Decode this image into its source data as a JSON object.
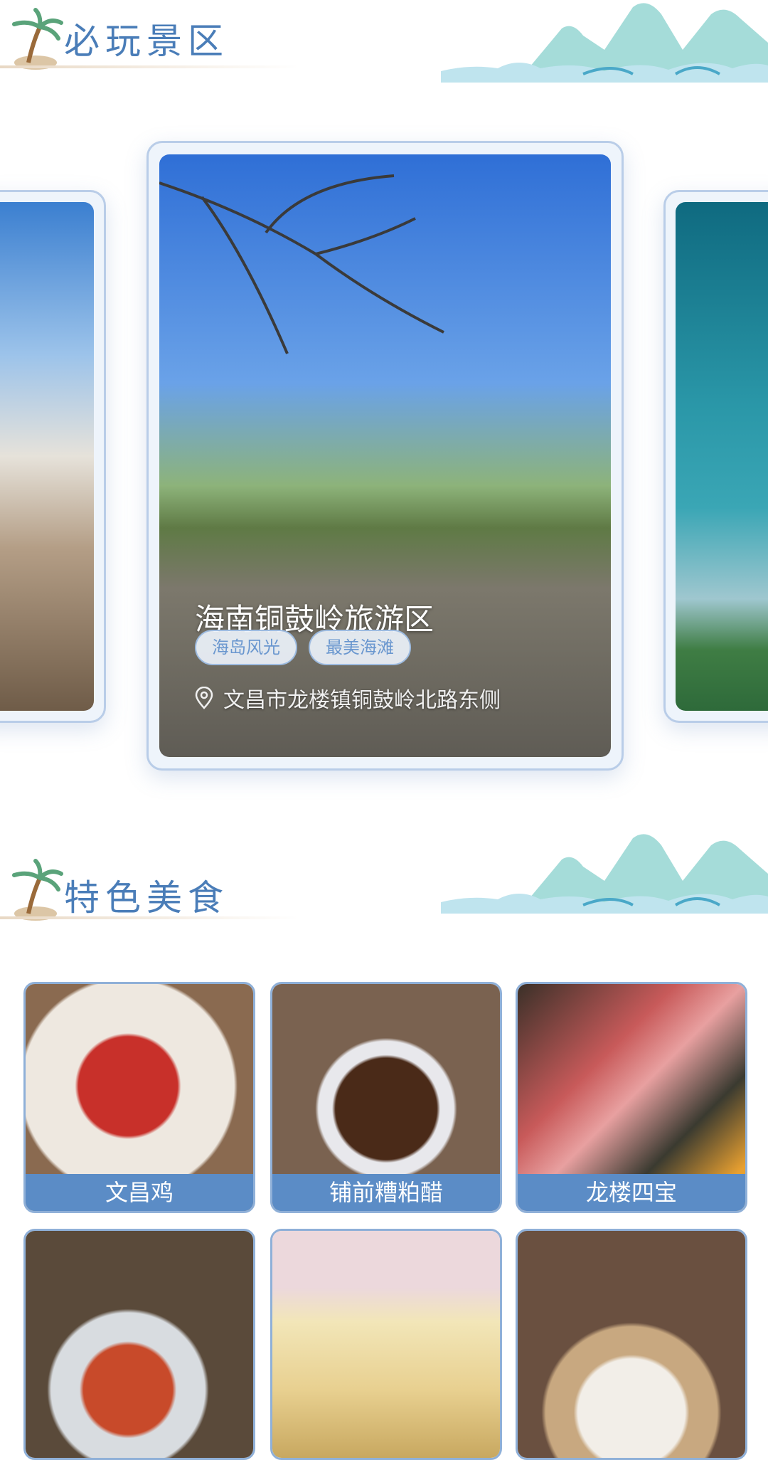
{
  "sections": {
    "scenic": {
      "title": "必玩景区"
    },
    "food": {
      "title": "特色美食"
    }
  },
  "carousel": {
    "active": {
      "name": "海南铜鼓岭旅游区",
      "tags": [
        "海岛风光",
        "最美海滩"
      ],
      "address": "文昌市龙楼镇铜鼓岭北路东侧",
      "icon": "location-pin-icon"
    }
  },
  "foods": [
    {
      "name": "文昌鸡"
    },
    {
      "name": "铺前糟粕醋"
    },
    {
      "name": "龙楼四宝"
    },
    {
      "name": ""
    },
    {
      "name": ""
    },
    {
      "name": ""
    }
  ],
  "colors": {
    "accent": "#4a7db8",
    "label_bg": "#5b8cc6",
    "card_border": "#b9cde8"
  }
}
